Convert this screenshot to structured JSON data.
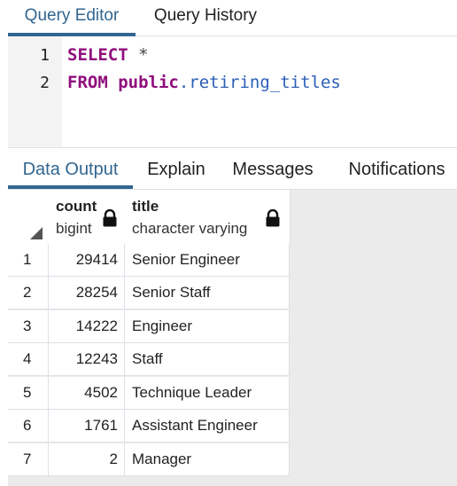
{
  "top_tabs": [
    {
      "label": "Query Editor",
      "active": true
    },
    {
      "label": "Query History",
      "active": false
    }
  ],
  "editor": {
    "lines": [
      {
        "number": "1",
        "tokens": [
          {
            "text": "SELECT",
            "kind": "keyword"
          },
          {
            "text": " *",
            "kind": "operator"
          }
        ]
      },
      {
        "number": "2",
        "tokens": [
          {
            "text": "FROM",
            "kind": "keyword"
          },
          {
            "text": " public",
            "kind": "schema"
          },
          {
            "text": ".retiring_titles",
            "kind": "identifier"
          }
        ]
      }
    ]
  },
  "output_tabs": [
    {
      "label": "Data Output",
      "active": true
    },
    {
      "label": "Explain",
      "active": false
    },
    {
      "label": "Messages",
      "active": false
    },
    {
      "label": "Notifications",
      "active": false
    }
  ],
  "grid": {
    "columns": [
      {
        "name": "count",
        "type": "bigint",
        "locked": true
      },
      {
        "name": "title",
        "type": "character varying",
        "locked": true
      }
    ],
    "rows": [
      {
        "num": "1",
        "count": "29414",
        "title": "Senior Engineer"
      },
      {
        "num": "2",
        "count": "28254",
        "title": "Senior Staff"
      },
      {
        "num": "3",
        "count": "14222",
        "title": "Engineer"
      },
      {
        "num": "4",
        "count": "12243",
        "title": "Staff"
      },
      {
        "num": "5",
        "count": "4502",
        "title": "Technique Leader"
      },
      {
        "num": "6",
        "count": "1761",
        "title": "Assistant Engineer"
      },
      {
        "num": "7",
        "count": "2",
        "title": "Manager"
      }
    ]
  },
  "colors": {
    "accent": "#326690",
    "keyword": "#900e7d",
    "identifier": "#2d5fb8",
    "gutter": "#f3f3f3",
    "grid_background": "#ebebeb"
  }
}
